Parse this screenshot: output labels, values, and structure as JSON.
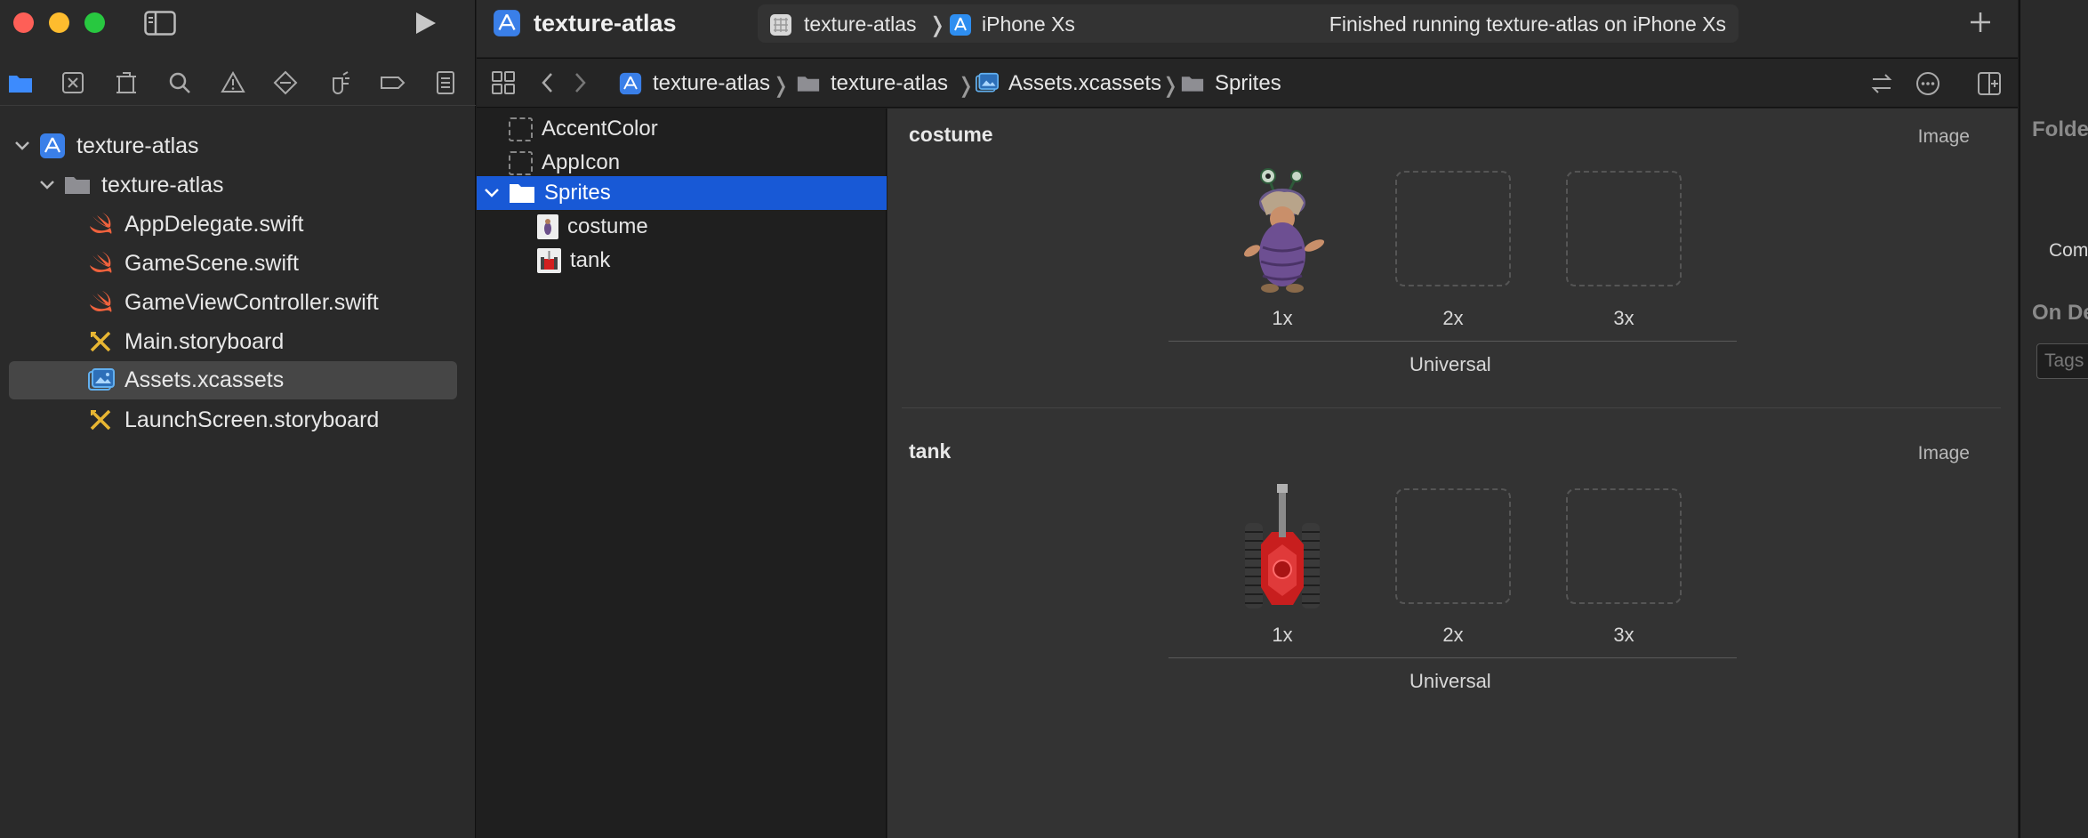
{
  "window": {
    "project_title": "texture-atlas",
    "scheme_target": "texture-atlas",
    "device": "iPhone Xs",
    "status": "Finished running texture-atlas on iPhone Xs",
    "colors": {
      "close": "#fe5f57",
      "minimize": "#febc2e",
      "zoom": "#28c840",
      "selection": "#1859d6",
      "accent": "#3d8bfd"
    }
  },
  "navigator": {
    "tabs": [
      "folder-icon",
      "source-control-icon",
      "symbol-icon",
      "search-icon",
      "warning-icon",
      "test-icon",
      "debug-icon",
      "breakpoint-icon",
      "report-icon"
    ],
    "tree": [
      {
        "label": "texture-atlas",
        "icon": "project-icon"
      },
      {
        "label": "texture-atlas",
        "icon": "folder-icon"
      },
      {
        "label": "AppDelegate.swift",
        "icon": "swift-icon"
      },
      {
        "label": "GameScene.swift",
        "icon": "swift-icon"
      },
      {
        "label": "GameViewController.swift",
        "icon": "swift-icon"
      },
      {
        "label": "Main.storyboard",
        "icon": "storyboard-icon"
      },
      {
        "label": "Assets.xcassets",
        "icon": "assets-icon",
        "selected": true
      },
      {
        "label": "LaunchScreen.storyboard",
        "icon": "storyboard-icon"
      }
    ]
  },
  "jumpbar": {
    "crumbs": [
      "texture-atlas",
      "texture-atlas",
      "Assets.xcassets",
      "Sprites"
    ]
  },
  "assets": {
    "items": [
      {
        "label": "AccentColor"
      },
      {
        "label": "AppIcon"
      },
      {
        "label": "Sprites",
        "selected": true
      },
      {
        "label": "costume"
      },
      {
        "label": "tank"
      }
    ]
  },
  "detail": {
    "sets": [
      {
        "name": "costume",
        "type": "Image",
        "scales": [
          "1x",
          "2x",
          "3x"
        ],
        "group": "Universal"
      },
      {
        "name": "tank",
        "type": "Image",
        "scales": [
          "1x",
          "2x",
          "3x"
        ],
        "group": "Universal"
      }
    ]
  },
  "inspector": {
    "folder_heading": "Folde",
    "compression_label": "Com",
    "on_demand_heading": "On De",
    "tags_placeholder": "Tags"
  }
}
